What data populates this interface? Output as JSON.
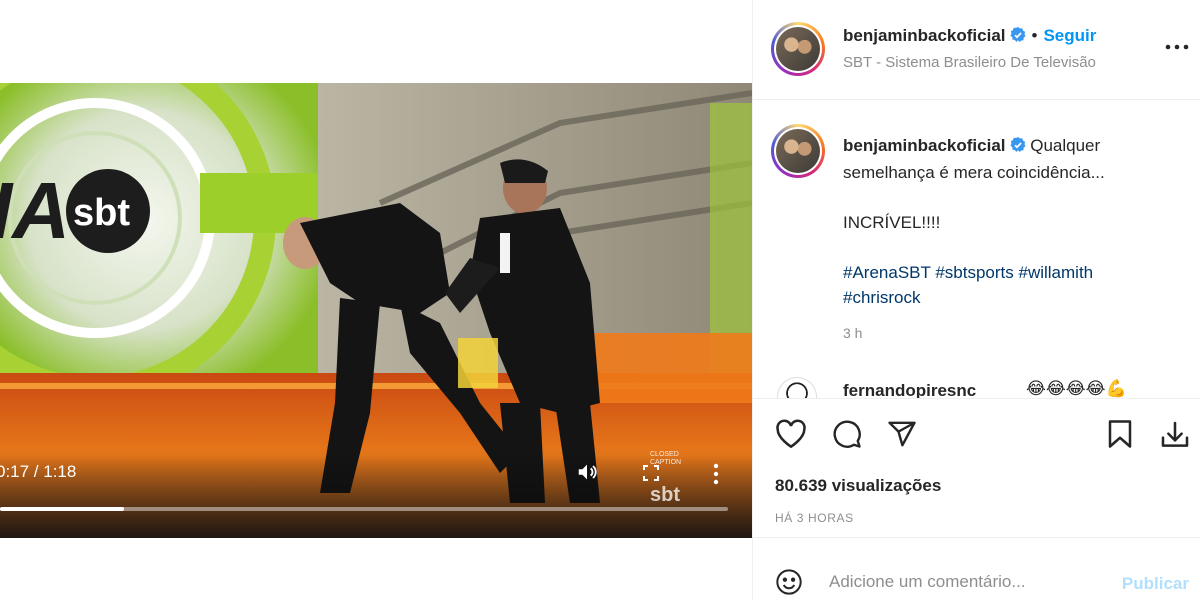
{
  "post": {
    "username": "benjaminbackoficial",
    "follow_label": "Seguir",
    "location": "SBT - Sistema Brasileiro De Televisão",
    "caption": {
      "line1": "Qualquer semelhança é mera coincidência...",
      "line2": "INCRÍVEL!!!!",
      "hashtags": [
        "#ArenaSBT",
        "#sbtsports",
        "#willamith",
        "#chrisrock"
      ]
    },
    "time_ago": "3 h",
    "comment_preview": {
      "username": "fernandopiresnc",
      "text": "😂😂😂😂💪"
    },
    "views": "80.639 visualizações",
    "posted_label": "HÁ 3 HORAS",
    "comment_placeholder": "Adicione um comentário...",
    "publish_label": "Publicar"
  },
  "video": {
    "time_display": "0:17 / 1:18",
    "progress": 0.17,
    "logo_text": "sbt",
    "cc_line1": "CLOSED",
    "cc_line2": "CAPTION",
    "watermark": "sbt"
  },
  "icons": {
    "verified": "verified-badge-icon",
    "more": "more-options-icon",
    "like": "heart-icon",
    "comment": "comment-bubble-icon",
    "share": "paper-plane-icon",
    "save": "bookmark-icon",
    "download": "download-icon",
    "emoji": "smiley-icon",
    "volume": "volume-icon",
    "fullscreen": "fullscreen-icon",
    "video_more": "vertical-dots-icon"
  },
  "colors": {
    "accent": "#0095f6",
    "publish_disabled": "#b2dffc",
    "hashtag": "#00376b",
    "muted": "#8e8e8e",
    "verified": "#3897f0"
  }
}
